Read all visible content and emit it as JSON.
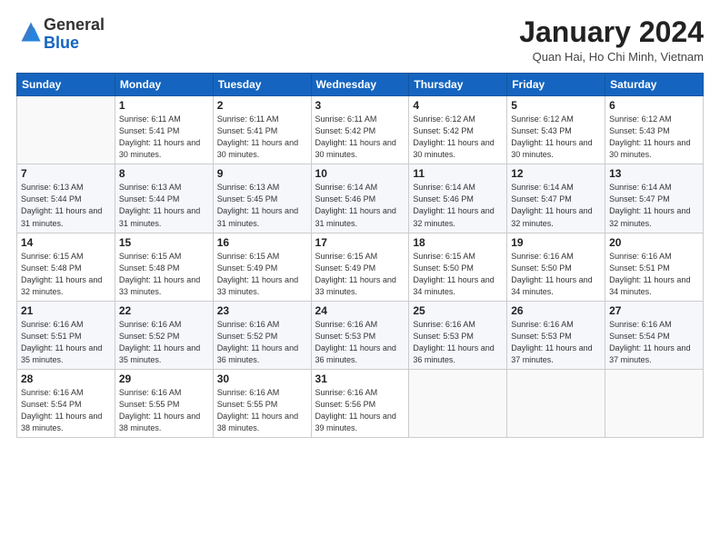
{
  "header": {
    "logo_general": "General",
    "logo_blue": "Blue",
    "month_title": "January 2024",
    "location": "Quan Hai, Ho Chi Minh, Vietnam"
  },
  "days_of_week": [
    "Sunday",
    "Monday",
    "Tuesday",
    "Wednesday",
    "Thursday",
    "Friday",
    "Saturday"
  ],
  "weeks": [
    [
      {
        "day": "",
        "sunrise": "",
        "sunset": "",
        "daylight": ""
      },
      {
        "day": "1",
        "sunrise": "Sunrise: 6:11 AM",
        "sunset": "Sunset: 5:41 PM",
        "daylight": "Daylight: 11 hours and 30 minutes."
      },
      {
        "day": "2",
        "sunrise": "Sunrise: 6:11 AM",
        "sunset": "Sunset: 5:41 PM",
        "daylight": "Daylight: 11 hours and 30 minutes."
      },
      {
        "day": "3",
        "sunrise": "Sunrise: 6:11 AM",
        "sunset": "Sunset: 5:42 PM",
        "daylight": "Daylight: 11 hours and 30 minutes."
      },
      {
        "day": "4",
        "sunrise": "Sunrise: 6:12 AM",
        "sunset": "Sunset: 5:42 PM",
        "daylight": "Daylight: 11 hours and 30 minutes."
      },
      {
        "day": "5",
        "sunrise": "Sunrise: 6:12 AM",
        "sunset": "Sunset: 5:43 PM",
        "daylight": "Daylight: 11 hours and 30 minutes."
      },
      {
        "day": "6",
        "sunrise": "Sunrise: 6:12 AM",
        "sunset": "Sunset: 5:43 PM",
        "daylight": "Daylight: 11 hours and 30 minutes."
      }
    ],
    [
      {
        "day": "7",
        "sunrise": "Sunrise: 6:13 AM",
        "sunset": "Sunset: 5:44 PM",
        "daylight": "Daylight: 11 hours and 31 minutes."
      },
      {
        "day": "8",
        "sunrise": "Sunrise: 6:13 AM",
        "sunset": "Sunset: 5:44 PM",
        "daylight": "Daylight: 11 hours and 31 minutes."
      },
      {
        "day": "9",
        "sunrise": "Sunrise: 6:13 AM",
        "sunset": "Sunset: 5:45 PM",
        "daylight": "Daylight: 11 hours and 31 minutes."
      },
      {
        "day": "10",
        "sunrise": "Sunrise: 6:14 AM",
        "sunset": "Sunset: 5:46 PM",
        "daylight": "Daylight: 11 hours and 31 minutes."
      },
      {
        "day": "11",
        "sunrise": "Sunrise: 6:14 AM",
        "sunset": "Sunset: 5:46 PM",
        "daylight": "Daylight: 11 hours and 32 minutes."
      },
      {
        "day": "12",
        "sunrise": "Sunrise: 6:14 AM",
        "sunset": "Sunset: 5:47 PM",
        "daylight": "Daylight: 11 hours and 32 minutes."
      },
      {
        "day": "13",
        "sunrise": "Sunrise: 6:14 AM",
        "sunset": "Sunset: 5:47 PM",
        "daylight": "Daylight: 11 hours and 32 minutes."
      }
    ],
    [
      {
        "day": "14",
        "sunrise": "Sunrise: 6:15 AM",
        "sunset": "Sunset: 5:48 PM",
        "daylight": "Daylight: 11 hours and 32 minutes."
      },
      {
        "day": "15",
        "sunrise": "Sunrise: 6:15 AM",
        "sunset": "Sunset: 5:48 PM",
        "daylight": "Daylight: 11 hours and 33 minutes."
      },
      {
        "day": "16",
        "sunrise": "Sunrise: 6:15 AM",
        "sunset": "Sunset: 5:49 PM",
        "daylight": "Daylight: 11 hours and 33 minutes."
      },
      {
        "day": "17",
        "sunrise": "Sunrise: 6:15 AM",
        "sunset": "Sunset: 5:49 PM",
        "daylight": "Daylight: 11 hours and 33 minutes."
      },
      {
        "day": "18",
        "sunrise": "Sunrise: 6:15 AM",
        "sunset": "Sunset: 5:50 PM",
        "daylight": "Daylight: 11 hours and 34 minutes."
      },
      {
        "day": "19",
        "sunrise": "Sunrise: 6:16 AM",
        "sunset": "Sunset: 5:50 PM",
        "daylight": "Daylight: 11 hours and 34 minutes."
      },
      {
        "day": "20",
        "sunrise": "Sunrise: 6:16 AM",
        "sunset": "Sunset: 5:51 PM",
        "daylight": "Daylight: 11 hours and 34 minutes."
      }
    ],
    [
      {
        "day": "21",
        "sunrise": "Sunrise: 6:16 AM",
        "sunset": "Sunset: 5:51 PM",
        "daylight": "Daylight: 11 hours and 35 minutes."
      },
      {
        "day": "22",
        "sunrise": "Sunrise: 6:16 AM",
        "sunset": "Sunset: 5:52 PM",
        "daylight": "Daylight: 11 hours and 35 minutes."
      },
      {
        "day": "23",
        "sunrise": "Sunrise: 6:16 AM",
        "sunset": "Sunset: 5:52 PM",
        "daylight": "Daylight: 11 hours and 36 minutes."
      },
      {
        "day": "24",
        "sunrise": "Sunrise: 6:16 AM",
        "sunset": "Sunset: 5:53 PM",
        "daylight": "Daylight: 11 hours and 36 minutes."
      },
      {
        "day": "25",
        "sunrise": "Sunrise: 6:16 AM",
        "sunset": "Sunset: 5:53 PM",
        "daylight": "Daylight: 11 hours and 36 minutes."
      },
      {
        "day": "26",
        "sunrise": "Sunrise: 6:16 AM",
        "sunset": "Sunset: 5:53 PM",
        "daylight": "Daylight: 11 hours and 37 minutes."
      },
      {
        "day": "27",
        "sunrise": "Sunrise: 6:16 AM",
        "sunset": "Sunset: 5:54 PM",
        "daylight": "Daylight: 11 hours and 37 minutes."
      }
    ],
    [
      {
        "day": "28",
        "sunrise": "Sunrise: 6:16 AM",
        "sunset": "Sunset: 5:54 PM",
        "daylight": "Daylight: 11 hours and 38 minutes."
      },
      {
        "day": "29",
        "sunrise": "Sunrise: 6:16 AM",
        "sunset": "Sunset: 5:55 PM",
        "daylight": "Daylight: 11 hours and 38 minutes."
      },
      {
        "day": "30",
        "sunrise": "Sunrise: 6:16 AM",
        "sunset": "Sunset: 5:55 PM",
        "daylight": "Daylight: 11 hours and 38 minutes."
      },
      {
        "day": "31",
        "sunrise": "Sunrise: 6:16 AM",
        "sunset": "Sunset: 5:56 PM",
        "daylight": "Daylight: 11 hours and 39 minutes."
      },
      {
        "day": "",
        "sunrise": "",
        "sunset": "",
        "daylight": ""
      },
      {
        "day": "",
        "sunrise": "",
        "sunset": "",
        "daylight": ""
      },
      {
        "day": "",
        "sunrise": "",
        "sunset": "",
        "daylight": ""
      }
    ]
  ]
}
